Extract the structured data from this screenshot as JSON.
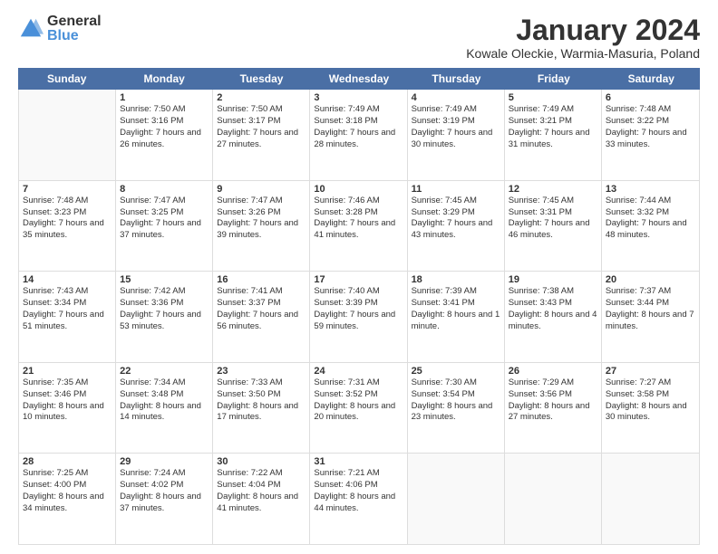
{
  "logo": {
    "general": "General",
    "blue": "Blue"
  },
  "title": "January 2024",
  "location": "Kowale Oleckie, Warmia-Masuria, Poland",
  "days": [
    "Sunday",
    "Monday",
    "Tuesday",
    "Wednesday",
    "Thursday",
    "Friday",
    "Saturday"
  ],
  "weeks": [
    [
      {
        "day": "",
        "sunrise": "",
        "sunset": "",
        "daylight": ""
      },
      {
        "day": "1",
        "sunrise": "Sunrise: 7:50 AM",
        "sunset": "Sunset: 3:16 PM",
        "daylight": "Daylight: 7 hours and 26 minutes."
      },
      {
        "day": "2",
        "sunrise": "Sunrise: 7:50 AM",
        "sunset": "Sunset: 3:17 PM",
        "daylight": "Daylight: 7 hours and 27 minutes."
      },
      {
        "day": "3",
        "sunrise": "Sunrise: 7:49 AM",
        "sunset": "Sunset: 3:18 PM",
        "daylight": "Daylight: 7 hours and 28 minutes."
      },
      {
        "day": "4",
        "sunrise": "Sunrise: 7:49 AM",
        "sunset": "Sunset: 3:19 PM",
        "daylight": "Daylight: 7 hours and 30 minutes."
      },
      {
        "day": "5",
        "sunrise": "Sunrise: 7:49 AM",
        "sunset": "Sunset: 3:21 PM",
        "daylight": "Daylight: 7 hours and 31 minutes."
      },
      {
        "day": "6",
        "sunrise": "Sunrise: 7:48 AM",
        "sunset": "Sunset: 3:22 PM",
        "daylight": "Daylight: 7 hours and 33 minutes."
      }
    ],
    [
      {
        "day": "7",
        "sunrise": "Sunrise: 7:48 AM",
        "sunset": "Sunset: 3:23 PM",
        "daylight": "Daylight: 7 hours and 35 minutes."
      },
      {
        "day": "8",
        "sunrise": "Sunrise: 7:47 AM",
        "sunset": "Sunset: 3:25 PM",
        "daylight": "Daylight: 7 hours and 37 minutes."
      },
      {
        "day": "9",
        "sunrise": "Sunrise: 7:47 AM",
        "sunset": "Sunset: 3:26 PM",
        "daylight": "Daylight: 7 hours and 39 minutes."
      },
      {
        "day": "10",
        "sunrise": "Sunrise: 7:46 AM",
        "sunset": "Sunset: 3:28 PM",
        "daylight": "Daylight: 7 hours and 41 minutes."
      },
      {
        "day": "11",
        "sunrise": "Sunrise: 7:45 AM",
        "sunset": "Sunset: 3:29 PM",
        "daylight": "Daylight: 7 hours and 43 minutes."
      },
      {
        "day": "12",
        "sunrise": "Sunrise: 7:45 AM",
        "sunset": "Sunset: 3:31 PM",
        "daylight": "Daylight: 7 hours and 46 minutes."
      },
      {
        "day": "13",
        "sunrise": "Sunrise: 7:44 AM",
        "sunset": "Sunset: 3:32 PM",
        "daylight": "Daylight: 7 hours and 48 minutes."
      }
    ],
    [
      {
        "day": "14",
        "sunrise": "Sunrise: 7:43 AM",
        "sunset": "Sunset: 3:34 PM",
        "daylight": "Daylight: 7 hours and 51 minutes."
      },
      {
        "day": "15",
        "sunrise": "Sunrise: 7:42 AM",
        "sunset": "Sunset: 3:36 PM",
        "daylight": "Daylight: 7 hours and 53 minutes."
      },
      {
        "day": "16",
        "sunrise": "Sunrise: 7:41 AM",
        "sunset": "Sunset: 3:37 PM",
        "daylight": "Daylight: 7 hours and 56 minutes."
      },
      {
        "day": "17",
        "sunrise": "Sunrise: 7:40 AM",
        "sunset": "Sunset: 3:39 PM",
        "daylight": "Daylight: 7 hours and 59 minutes."
      },
      {
        "day": "18",
        "sunrise": "Sunrise: 7:39 AM",
        "sunset": "Sunset: 3:41 PM",
        "daylight": "Daylight: 8 hours and 1 minute."
      },
      {
        "day": "19",
        "sunrise": "Sunrise: 7:38 AM",
        "sunset": "Sunset: 3:43 PM",
        "daylight": "Daylight: 8 hours and 4 minutes."
      },
      {
        "day": "20",
        "sunrise": "Sunrise: 7:37 AM",
        "sunset": "Sunset: 3:44 PM",
        "daylight": "Daylight: 8 hours and 7 minutes."
      }
    ],
    [
      {
        "day": "21",
        "sunrise": "Sunrise: 7:35 AM",
        "sunset": "Sunset: 3:46 PM",
        "daylight": "Daylight: 8 hours and 10 minutes."
      },
      {
        "day": "22",
        "sunrise": "Sunrise: 7:34 AM",
        "sunset": "Sunset: 3:48 PM",
        "daylight": "Daylight: 8 hours and 14 minutes."
      },
      {
        "day": "23",
        "sunrise": "Sunrise: 7:33 AM",
        "sunset": "Sunset: 3:50 PM",
        "daylight": "Daylight: 8 hours and 17 minutes."
      },
      {
        "day": "24",
        "sunrise": "Sunrise: 7:31 AM",
        "sunset": "Sunset: 3:52 PM",
        "daylight": "Daylight: 8 hours and 20 minutes."
      },
      {
        "day": "25",
        "sunrise": "Sunrise: 7:30 AM",
        "sunset": "Sunset: 3:54 PM",
        "daylight": "Daylight: 8 hours and 23 minutes."
      },
      {
        "day": "26",
        "sunrise": "Sunrise: 7:29 AM",
        "sunset": "Sunset: 3:56 PM",
        "daylight": "Daylight: 8 hours and 27 minutes."
      },
      {
        "day": "27",
        "sunrise": "Sunrise: 7:27 AM",
        "sunset": "Sunset: 3:58 PM",
        "daylight": "Daylight: 8 hours and 30 minutes."
      }
    ],
    [
      {
        "day": "28",
        "sunrise": "Sunrise: 7:25 AM",
        "sunset": "Sunset: 4:00 PM",
        "daylight": "Daylight: 8 hours and 34 minutes."
      },
      {
        "day": "29",
        "sunrise": "Sunrise: 7:24 AM",
        "sunset": "Sunset: 4:02 PM",
        "daylight": "Daylight: 8 hours and 37 minutes."
      },
      {
        "day": "30",
        "sunrise": "Sunrise: 7:22 AM",
        "sunset": "Sunset: 4:04 PM",
        "daylight": "Daylight: 8 hours and 41 minutes."
      },
      {
        "day": "31",
        "sunrise": "Sunrise: 7:21 AM",
        "sunset": "Sunset: 4:06 PM",
        "daylight": "Daylight: 8 hours and 44 minutes."
      },
      {
        "day": "",
        "sunrise": "",
        "sunset": "",
        "daylight": ""
      },
      {
        "day": "",
        "sunrise": "",
        "sunset": "",
        "daylight": ""
      },
      {
        "day": "",
        "sunrise": "",
        "sunset": "",
        "daylight": ""
      }
    ]
  ]
}
